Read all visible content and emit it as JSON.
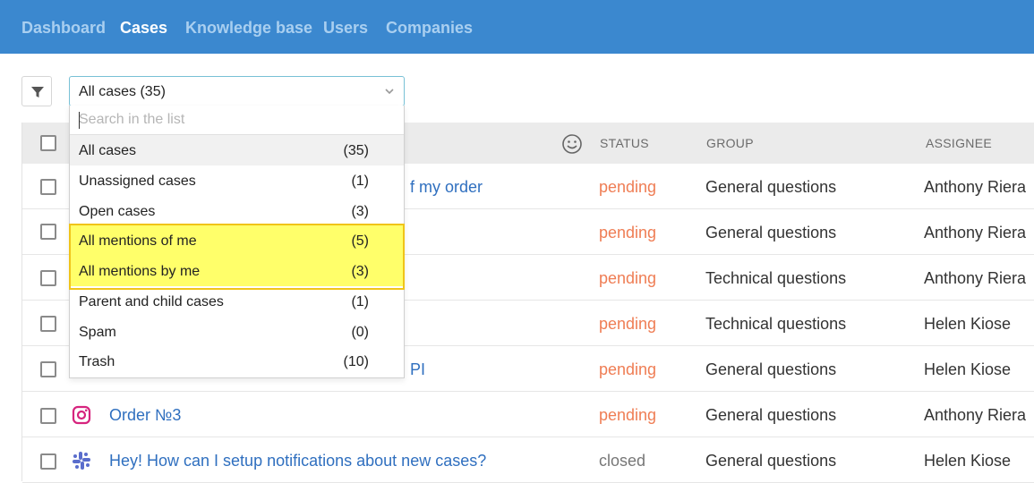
{
  "nav": {
    "items": [
      {
        "label": "Dashboard",
        "active": false
      },
      {
        "label": "Cases",
        "active": true
      },
      {
        "label": "Knowledge base",
        "active": false
      },
      {
        "label": "Users",
        "active": false
      },
      {
        "label": "Companies",
        "active": false
      }
    ]
  },
  "toolbar": {
    "filter_icon": "filter-icon",
    "select_value": "All cases (35)"
  },
  "dropdown": {
    "search_placeholder": "Search in the list",
    "options": [
      {
        "label": "All cases",
        "count": "(35)",
        "selected": true,
        "highlighted": false
      },
      {
        "label": "Unassigned cases",
        "count": "(1)",
        "selected": false,
        "highlighted": false
      },
      {
        "label": "Open cases",
        "count": "(3)",
        "selected": false,
        "highlighted": false
      },
      {
        "label": "All mentions of me",
        "count": "(5)",
        "selected": false,
        "highlighted": true
      },
      {
        "label": "All mentions by me",
        "count": "(3)",
        "selected": false,
        "highlighted": true
      },
      {
        "label": "Parent and child cases",
        "count": "(1)",
        "selected": false,
        "highlighted": false
      },
      {
        "label": "Spam",
        "count": "(0)",
        "selected": false,
        "highlighted": false
      },
      {
        "label": "Trash",
        "count": "(10)",
        "selected": false,
        "highlighted": false
      }
    ]
  },
  "table": {
    "headers": {
      "status": "STATUS",
      "group": "GROUP",
      "assignee": "ASSIGNEE",
      "rating_icon": "smiley-icon"
    },
    "rows": [
      {
        "channel": "",
        "subject": "f my order",
        "status": "pending",
        "group": "General questions",
        "assignee": "Anthony Riera"
      },
      {
        "channel": "",
        "subject": "",
        "status": "pending",
        "group": "General questions",
        "assignee": "Anthony Riera"
      },
      {
        "channel": "",
        "subject": "",
        "status": "pending",
        "group": "Technical questions",
        "assignee": "Anthony Riera"
      },
      {
        "channel": "",
        "subject": "",
        "status": "pending",
        "group": "Technical questions",
        "assignee": "Helen Kiose"
      },
      {
        "channel": "",
        "subject": "PI",
        "status": "pending",
        "group": "General questions",
        "assignee": "Helen Kiose"
      },
      {
        "channel": "instagram-icon",
        "subject": "Order №3",
        "status": "pending",
        "group": "General questions",
        "assignee": "Anthony Riera"
      },
      {
        "channel": "slack-icon",
        "subject": "Hey! How can I setup notifications about new cases?",
        "status": "closed",
        "group": "General questions",
        "assignee": "Helen Kiose"
      }
    ]
  },
  "colors": {
    "header_bg": "#3b88cf",
    "nav_active": "#ffffff",
    "nav_inactive": "#a9cff0",
    "status_pending": "#ef7d54",
    "status_closed": "#777777",
    "link": "#2f6fbf",
    "highlight": "#ffff6a",
    "instagram": "#d6247e",
    "slack": "#5a6dcc"
  }
}
